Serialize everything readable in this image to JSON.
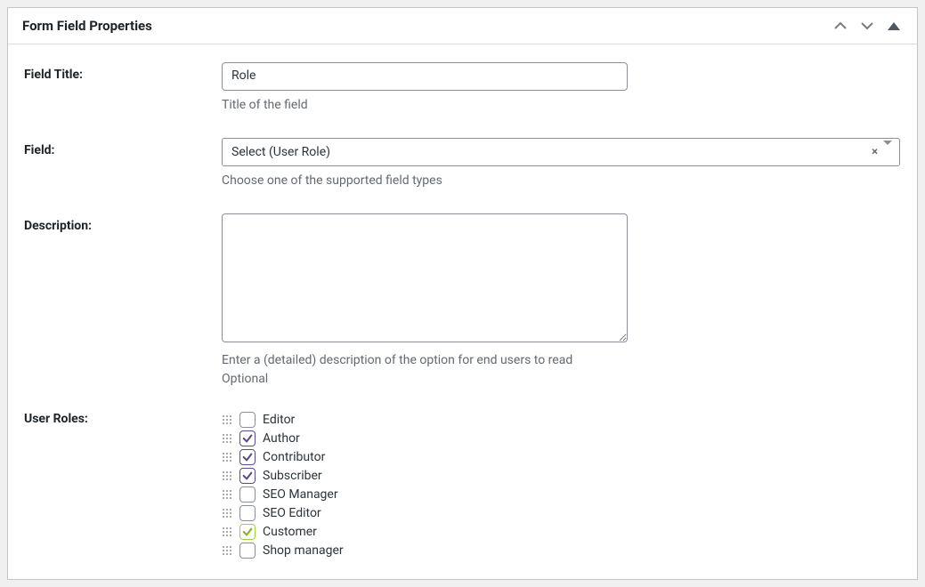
{
  "panel": {
    "title": "Form Field Properties"
  },
  "fieldTitle": {
    "label": "Field Title:",
    "value": "Role",
    "help": "Title of the field"
  },
  "field": {
    "label": "Field:",
    "selected": "Select (User Role)",
    "clearSymbol": "×",
    "help": "Choose one of the supported field types"
  },
  "description": {
    "label": "Description:",
    "value": "",
    "help1": "Enter a (detailed) description of the option for end users to read",
    "help2": "Optional"
  },
  "userRoles": {
    "label": "User Roles:",
    "items": [
      {
        "label": "Editor",
        "checked": false,
        "style": "purple"
      },
      {
        "label": "Author",
        "checked": true,
        "style": "purple"
      },
      {
        "label": "Contributor",
        "checked": true,
        "style": "purple"
      },
      {
        "label": "Subscriber",
        "checked": true,
        "style": "purple"
      },
      {
        "label": "SEO Manager",
        "checked": false,
        "style": "purple"
      },
      {
        "label": "SEO Editor",
        "checked": false,
        "style": "purple"
      },
      {
        "label": "Customer",
        "checked": true,
        "style": "lime"
      },
      {
        "label": "Shop manager",
        "checked": false,
        "style": "purple"
      }
    ]
  }
}
